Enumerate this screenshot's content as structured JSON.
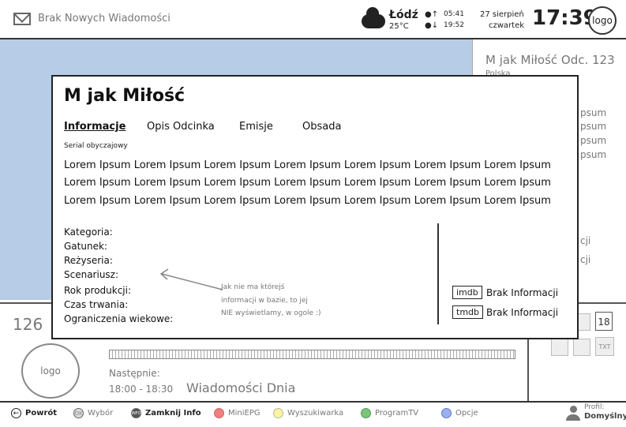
{
  "topbar": {
    "messages": "Brak Nowych Wiadomości",
    "city": "Łódź",
    "temperature": "25°C",
    "sunrise": "05:41",
    "sunset": "19:52",
    "date": "27 sierpień",
    "weekday": "czwartek",
    "time": "17:39",
    "logo": "logo"
  },
  "right_panel": {
    "title": "M jak Miłość Odc. 123",
    "country": "Polska",
    "lines": [
      "psum",
      "psum",
      "psum",
      "psum"
    ],
    "cji": [
      "cji",
      "cji"
    ]
  },
  "modal": {
    "title": "M jak Miłość",
    "tabs": [
      "Informacje",
      "Opis Odcinka",
      "Emisje",
      "Obsada"
    ],
    "genre_note": "Serial obyczajowy",
    "lorem_lines": [
      "Lorem Ipsum Lorem Ipsum Lorem Ipsum Lorem Ipsum Lorem Ipsum Lorem Ipsum Lorem Ipsum",
      "Lorem Ipsum Lorem Ipsum Lorem Ipsum Lorem Ipsum Lorem Ipsum Lorem Ipsum Lorem Ipsum",
      "Lorem Ipsum Lorem Ipsum Lorem Ipsum Lorem Ipsum Lorem Ipsum Lorem Ipsum Lorem Ipsum"
    ],
    "meta_labels": [
      "Kategoria:",
      "Gatunek:",
      "Reżyseria:",
      "Scenariusz:",
      "Rok produkcji:",
      "Czas trwania:",
      "Ograniczenia wiekowe:"
    ],
    "annotation": [
      "Jak nie ma którejś",
      "informacji w bazie, to jej",
      "NIE wyświetlamy, w ogole :)"
    ],
    "imdb_label": "imdb",
    "imdb_value": "Brak Informacji",
    "tmdb_label": "tmdb",
    "tmdb_value": "Brak Informacji"
  },
  "lower": {
    "channel_number": "126",
    "logo": "logo",
    "next_label": "Następnie:",
    "next_time": "18:00 - 18:30",
    "next_title": "Wiadomości Dnia",
    "age_rating": "18",
    "txt": "TXT"
  },
  "bottombar": {
    "back": "Powrót",
    "ok": "Wybór",
    "ok_key": "OK",
    "info": "Zamknij Info",
    "info_key": "INFO",
    "red": "MiniEPG",
    "yellow": "Wyszukiwarka",
    "green": "ProgramTV",
    "blue": "Opcje",
    "profile_label": "Profil:",
    "profile_value": "Domyślny"
  },
  "colors": {
    "video_bg": "#b7cce6",
    "red": "#f08080",
    "yellow": "#f8f4a0",
    "green": "#7cc47c",
    "blue": "#9bb0ee"
  }
}
